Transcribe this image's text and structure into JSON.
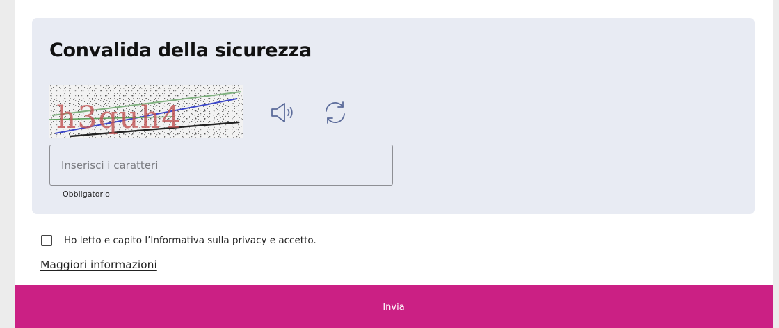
{
  "security": {
    "title": "Convalida della sicurezza",
    "captcha_text": "h3quh4",
    "captcha_image_icon": "captcha-image",
    "audio_icon": "speaker-icon",
    "refresh_icon": "refresh-icon",
    "input_value": "",
    "input_placeholder": "Inserisci i caratteri",
    "required_label": "Obbligatorio"
  },
  "consent": {
    "checked": false,
    "label": "Ho letto e capito l’Informativa sulla privacy e accetto.",
    "more_info_link": "Maggiori informazioni"
  },
  "submit": {
    "label": "Invia"
  },
  "colors": {
    "panel_background": "#e8ebf3",
    "submit_background": "#cb2084",
    "icon_color": "#5b6b9a"
  }
}
